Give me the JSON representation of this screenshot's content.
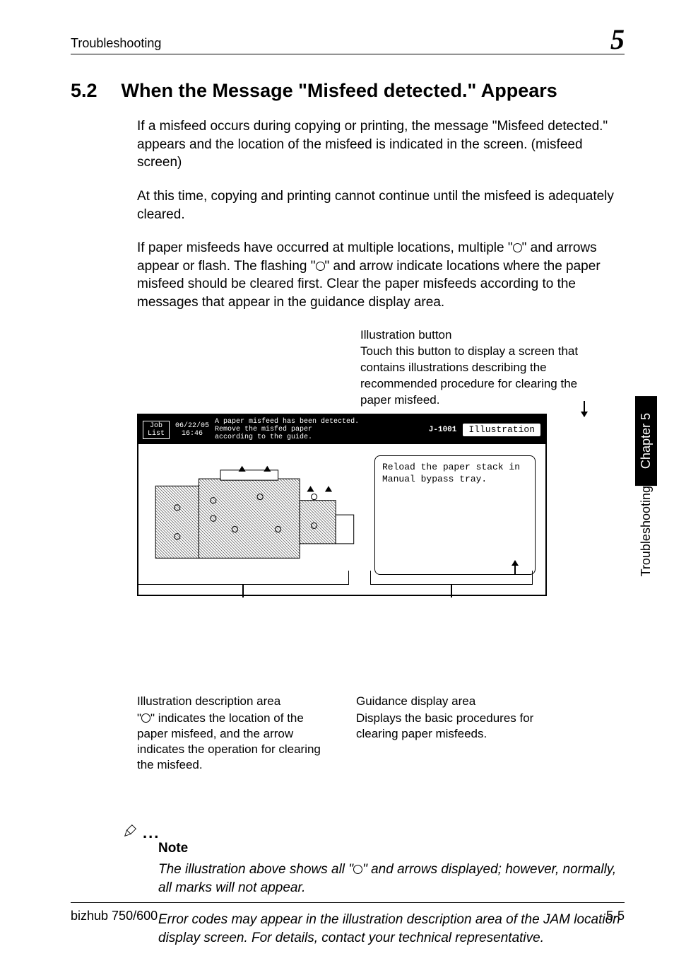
{
  "header": {
    "left": "Troubleshooting",
    "right": "5"
  },
  "section": {
    "num": "5.2",
    "title": "When the Message \"Misfeed detected.\" Appears"
  },
  "paragraphs": {
    "p1": "If a misfeed occurs during copying or printing, the message \"Misfeed detected.\" appears and the location of the misfeed is indicated in the screen. (misfeed screen)",
    "p2": "At this time, copying and printing cannot continue until the misfeed is adequately cleared.",
    "p3a": "If paper misfeeds have occurred at multiple locations, multiple \"",
    "p3b": "\" and arrows appear or flash. The flashing \"",
    "p3c": "\" and arrow indicate locations where the paper misfeed should be cleared first. Clear the paper misfeeds according to the messages that appear in the guidance display area."
  },
  "callout_top": {
    "title": "Illustration button",
    "body": "Touch this button to display a screen that contains illustrations describing the recommended procedure for clearing the paper misfeed."
  },
  "lcd": {
    "job_list": "Job\nList",
    "datetime": "06/22/05\n16:46",
    "message": "A paper misfeed has been detected.\nRemove the misfed paper\naccording to the guide.",
    "error_code": "J-1001",
    "illustration_btn": "Illustration",
    "guidance": "Reload the paper stack in Manual bypass tray."
  },
  "callout_left": {
    "title": "Illustration description area",
    "body_a": "\"",
    "body_b": "\" indicates the location of the paper misfeed, and the arrow indicates the operation for clearing the misfeed."
  },
  "callout_right": {
    "title": "Guidance display area",
    "body": "Displays the basic procedures for clearing paper misfeeds."
  },
  "note": {
    "label": "Note",
    "p1a": "The illustration above shows all \"",
    "p1b": "\" and arrows displayed; however, normally, all marks will not appear.",
    "p2": "Error codes may appear in the illustration description area of the JAM location display screen. For details, contact your technical representative."
  },
  "side_tab": {
    "black": "Chapter 5",
    "white": "Troubleshooting"
  },
  "footer": {
    "left": "bizhub 750/600",
    "right": "5-5"
  }
}
